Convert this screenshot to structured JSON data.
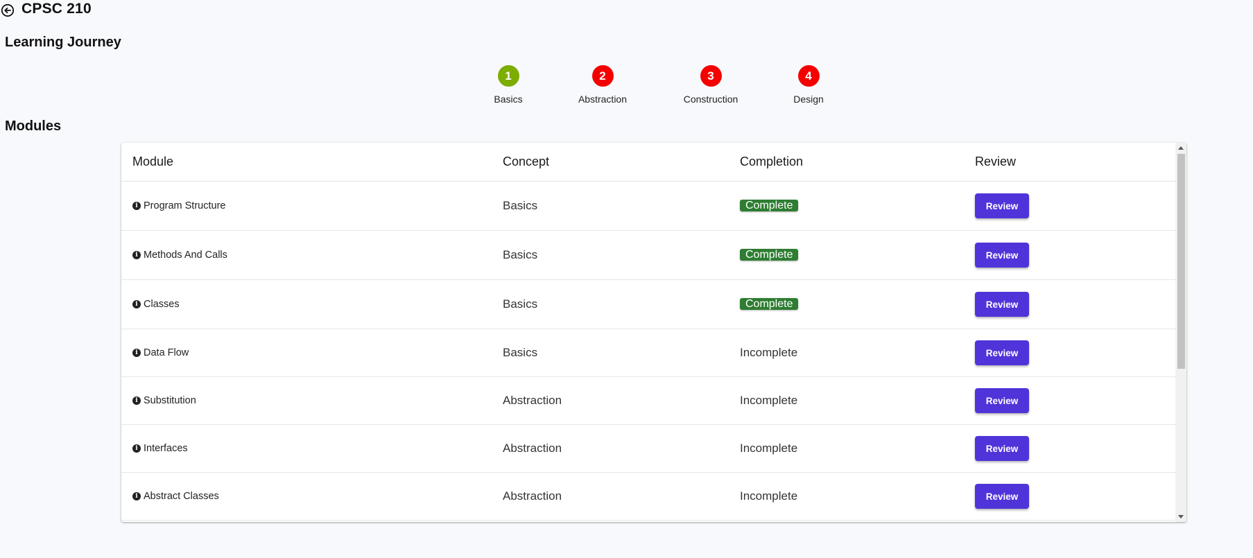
{
  "header": {
    "course_title": "CPSC 210",
    "back_icon": "arrow-left-circle-icon"
  },
  "journey": {
    "title": "Learning Journey",
    "steps": [
      {
        "number": "1",
        "label": "Basics",
        "color": "#7cad00"
      },
      {
        "number": "2",
        "label": "Abstraction",
        "color": "#f50000"
      },
      {
        "number": "3",
        "label": "Construction",
        "color": "#f50000"
      },
      {
        "number": "4",
        "label": "Design",
        "color": "#f50000"
      }
    ]
  },
  "modules": {
    "title": "Modules",
    "columns": {
      "module": "Module",
      "concept": "Concept",
      "completion": "Completion",
      "review": "Review"
    },
    "rows": [
      {
        "module": "Program Structure",
        "concept": "Basics",
        "completion": "Complete",
        "complete": true,
        "review": "Review"
      },
      {
        "module": "Methods And Calls",
        "concept": "Basics",
        "completion": "Complete",
        "complete": true,
        "review": "Review"
      },
      {
        "module": "Classes",
        "concept": "Basics",
        "completion": "Complete",
        "complete": true,
        "review": "Review"
      },
      {
        "module": "Data Flow",
        "concept": "Basics",
        "completion": "Incomplete",
        "complete": false,
        "review": "Review"
      },
      {
        "module": "Substitution",
        "concept": "Abstraction",
        "completion": "Incomplete",
        "complete": false,
        "review": "Review"
      },
      {
        "module": "Interfaces",
        "concept": "Abstraction",
        "completion": "Incomplete",
        "complete": false,
        "review": "Review"
      },
      {
        "module": "Abstract Classes",
        "concept": "Abstraction",
        "completion": "Incomplete",
        "complete": false,
        "review": "Review"
      }
    ]
  },
  "colors": {
    "complete_badge": "#2e7d32",
    "review_button": "#5034d9",
    "step_done": "#7cad00",
    "step_todo": "#f50000"
  }
}
